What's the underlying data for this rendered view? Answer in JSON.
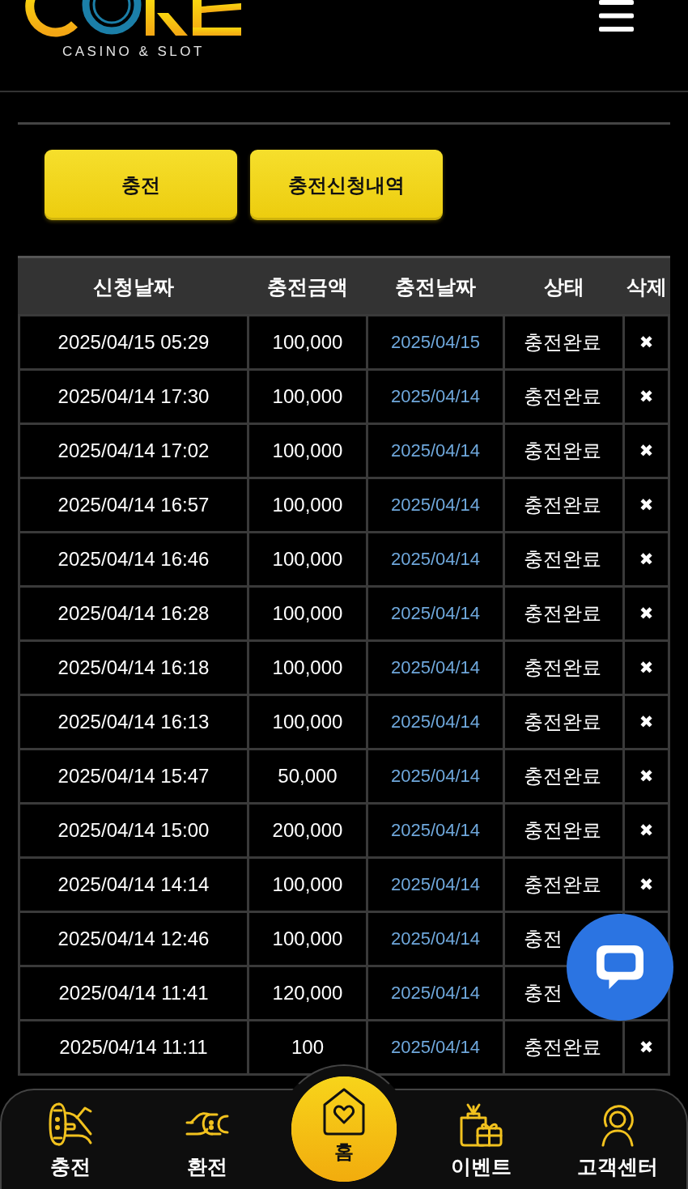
{
  "header": {
    "logo_tagline": "CASINO & SLOT"
  },
  "buttons": [
    {
      "label": "충전"
    },
    {
      "label": "충전신청내역"
    }
  ],
  "table": {
    "columns": [
      "신청날짜",
      "충전금액",
      "충전날짜",
      "상태",
      "삭제"
    ],
    "rows": [
      {
        "requested": "2025/04/15 05:29",
        "amount": "100,000",
        "charged": "2025/04/15",
        "status": "충전완료",
        "delete": "✖"
      },
      {
        "requested": "2025/04/14 17:30",
        "amount": "100,000",
        "charged": "2025/04/14",
        "status": "충전완료",
        "delete": "✖"
      },
      {
        "requested": "2025/04/14 17:02",
        "amount": "100,000",
        "charged": "2025/04/14",
        "status": "충전완료",
        "delete": "✖"
      },
      {
        "requested": "2025/04/14 16:57",
        "amount": "100,000",
        "charged": "2025/04/14",
        "status": "충전완료",
        "delete": "✖"
      },
      {
        "requested": "2025/04/14 16:46",
        "amount": "100,000",
        "charged": "2025/04/14",
        "status": "충전완료",
        "delete": "✖"
      },
      {
        "requested": "2025/04/14 16:28",
        "amount": "100,000",
        "charged": "2025/04/14",
        "status": "충전완료",
        "delete": "✖"
      },
      {
        "requested": "2025/04/14 16:18",
        "amount": "100,000",
        "charged": "2025/04/14",
        "status": "충전완료",
        "delete": "✖"
      },
      {
        "requested": "2025/04/14 16:13",
        "amount": "100,000",
        "charged": "2025/04/14",
        "status": "충전완료",
        "delete": "✖"
      },
      {
        "requested": "2025/04/14 15:47",
        "amount": "50,000",
        "charged": "2025/04/14",
        "status": "충전완료",
        "delete": "✖"
      },
      {
        "requested": "2025/04/14 15:00",
        "amount": "200,000",
        "charged": "2025/04/14",
        "status": "충전완료",
        "delete": "✖"
      },
      {
        "requested": "2025/04/14 14:14",
        "amount": "100,000",
        "charged": "2025/04/14",
        "status": "충전완료",
        "delete": "✖"
      },
      {
        "requested": "2025/04/14 12:46",
        "amount": "100,000",
        "charged": "2025/04/14",
        "status": "충전"
      },
      {
        "requested": "2025/04/14 11:41",
        "amount": "120,000",
        "charged": "2025/04/14",
        "status": "충전"
      },
      {
        "requested": "2025/04/14 11:11",
        "amount": "100",
        "charged": "2025/04/14",
        "status": "충전완료",
        "delete": "✖"
      }
    ]
  },
  "bottom_nav": [
    {
      "label": "충전",
      "kind": "plain"
    },
    {
      "label": "환전",
      "kind": "plain"
    },
    {
      "label": "홈",
      "kind": "center"
    },
    {
      "label": "이벤트",
      "kind": "plain"
    },
    {
      "label": "고객센터",
      "kind": "plain"
    }
  ]
}
